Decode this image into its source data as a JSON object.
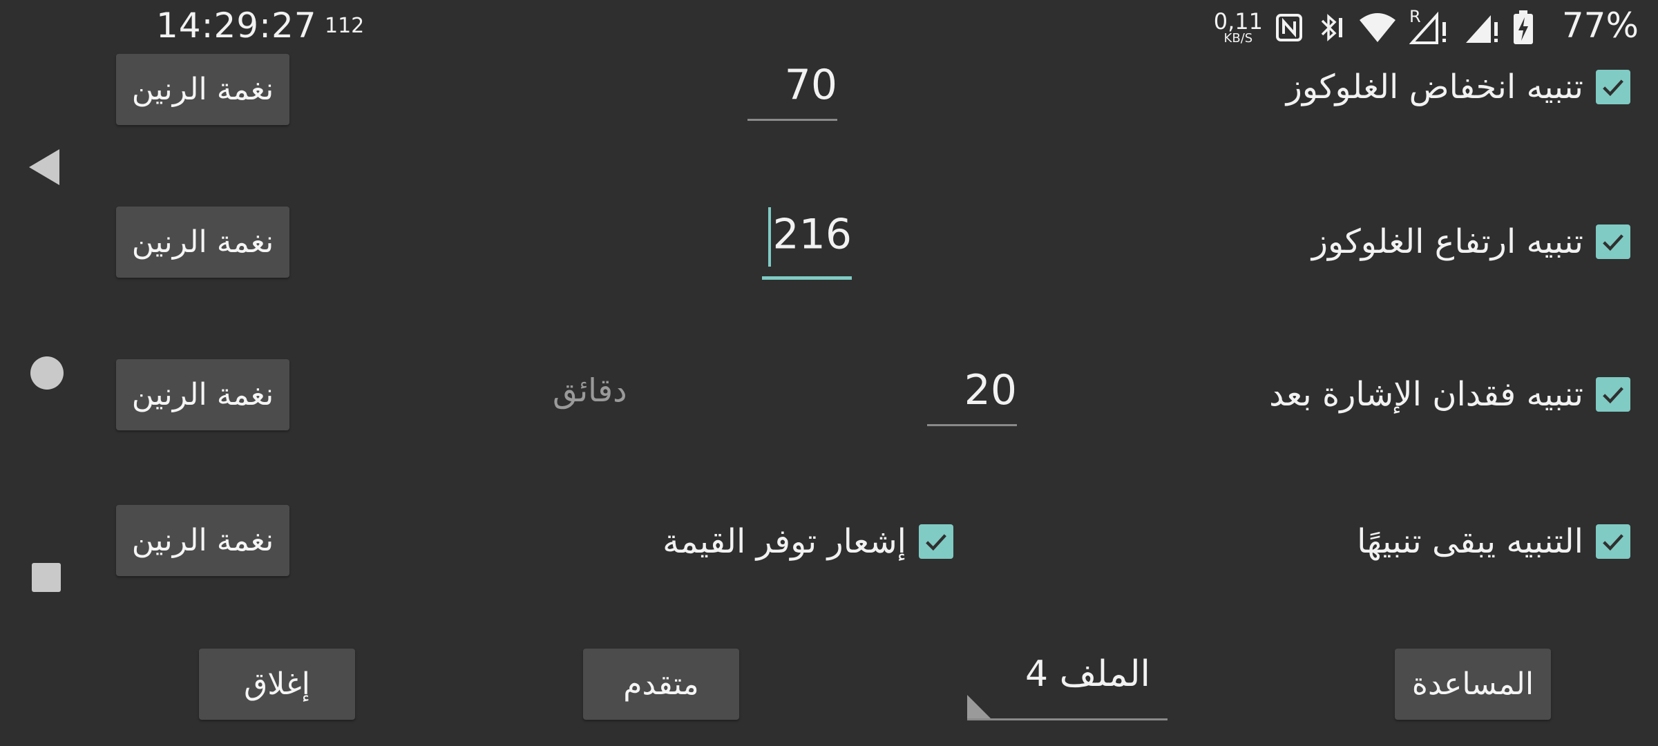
{
  "status_bar": {
    "time": "14:29:27",
    "notification_count": "112",
    "net_speed_value": "0,11",
    "net_speed_unit": "KB/S",
    "roaming_label": "R",
    "battery_percent": "77%"
  },
  "rows": {
    "low_alert": {
      "label": "تنبيه انخفاض الغلوكوز",
      "checked": true,
      "value": "70"
    },
    "high_alert": {
      "label": "تنبيه ارتفاع الغلوكوز",
      "checked": true,
      "value": "216"
    },
    "signal_loss": {
      "label": "تنبيه فقدان الإشارة بعد",
      "checked": true,
      "value": "20",
      "unit": "دقائق"
    },
    "keep_alerting": {
      "label": "التنبيه يبقى تنبيهًا",
      "checked": true
    },
    "value_available": {
      "label": "إشعار توفر القيمة",
      "checked": true
    }
  },
  "ringtone_label": "نغمة الرنين",
  "bottom": {
    "help": "المساعدة",
    "profile": "الملف 4",
    "advanced": "متقدم",
    "close": "إغلاق"
  },
  "colors": {
    "accent": "#80cbc4",
    "background": "#2f2f2f",
    "button": "#4c4c4c"
  },
  "icons": [
    "back-icon",
    "home-icon",
    "recents-icon",
    "nfc-icon",
    "bluetooth-icon",
    "wifi-icon",
    "signal-icon",
    "battery-charging-icon",
    "check-icon"
  ]
}
